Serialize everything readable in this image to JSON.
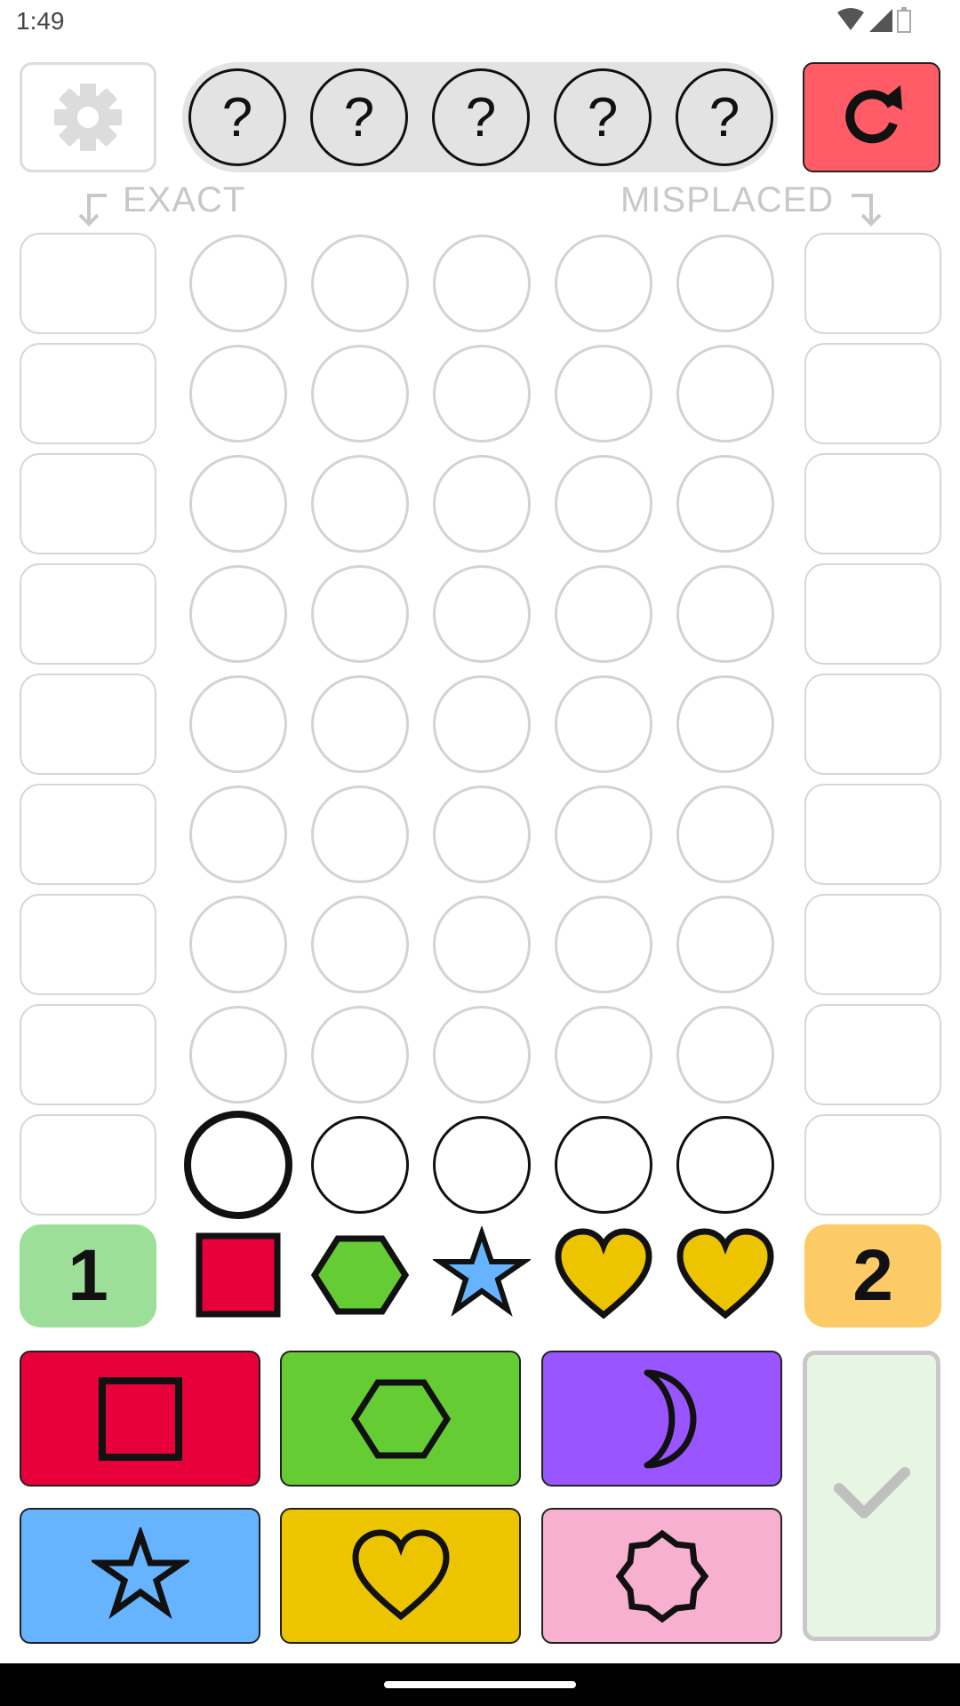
{
  "status_bar": {
    "time": "1:49"
  },
  "secret": {
    "pegs": [
      "?",
      "?",
      "?",
      "?",
      "?"
    ]
  },
  "labels": {
    "exact": "EXACT",
    "misplaced": "MISPLACED"
  },
  "board": {
    "rows": 9,
    "columns": 5,
    "active_row": 9,
    "selected_slot": 1
  },
  "hints": {
    "exact_count": "1",
    "misplaced_count": "2"
  },
  "last_guess": [
    "red-square",
    "green-hexagon",
    "blue-star",
    "yellow-heart",
    "yellow-heart"
  ],
  "palette": [
    {
      "name": "red-square",
      "color": "#e8003a"
    },
    {
      "name": "green-hexagon",
      "color": "#66cc33"
    },
    {
      "name": "purple-moon",
      "color": "#9955ff"
    },
    {
      "name": "blue-star",
      "color": "#66b3ff"
    },
    {
      "name": "yellow-heart",
      "color": "#ecc400"
    },
    {
      "name": "pink-octagram",
      "color": "#f7b0cf"
    }
  ],
  "colors": {
    "exact_hint_bg": "#9ddf98",
    "misplaced_hint_bg": "#fdcb66",
    "reset_bg": "#ff5c67",
    "submit_bg": "#e6f6e2"
  }
}
